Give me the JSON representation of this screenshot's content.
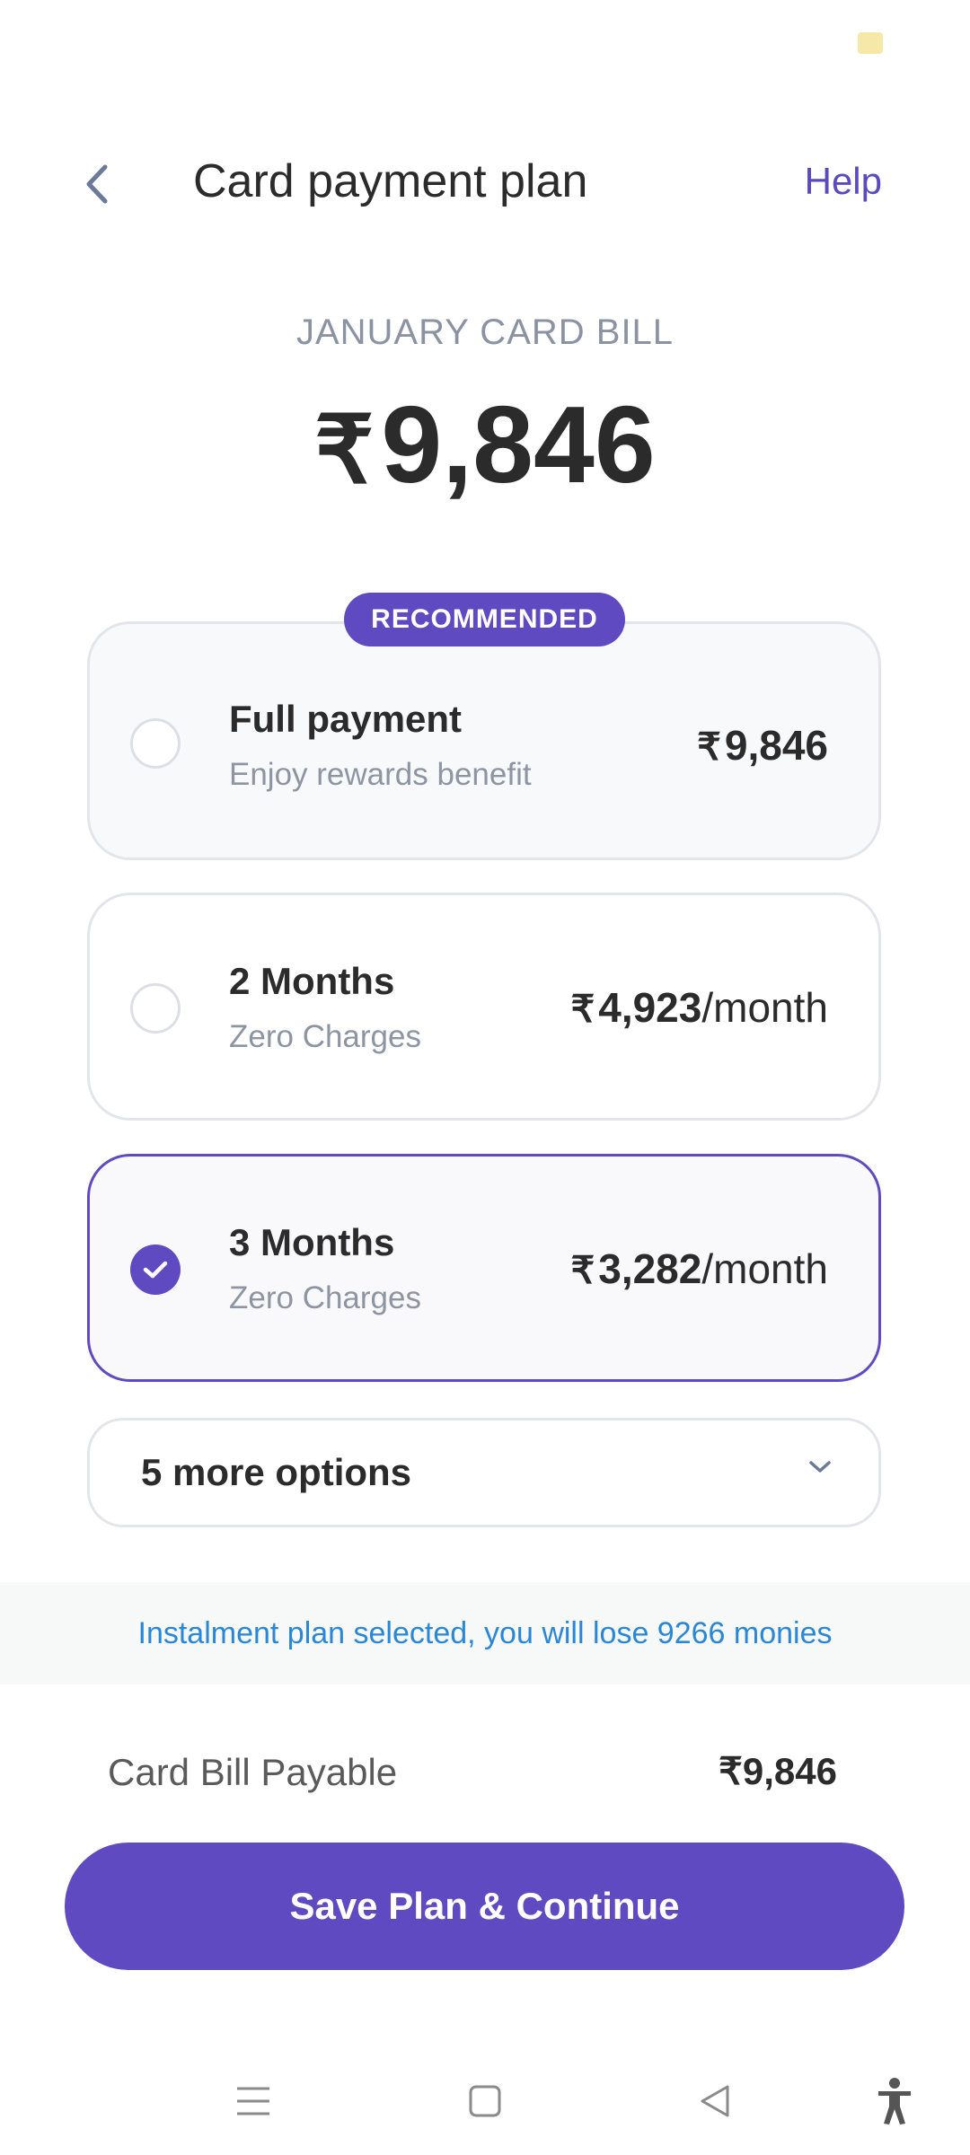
{
  "header": {
    "title": "Card payment plan",
    "help_label": "Help"
  },
  "bill": {
    "label": "JANUARY CARD BILL",
    "currency": "₹",
    "amount": "9,846"
  },
  "plans": [
    {
      "badge": "RECOMMENDED",
      "title": "Full payment",
      "subtitle": "Enjoy rewards benefit",
      "currency": "₹",
      "price": "9,846",
      "suffix": "",
      "selected": false
    },
    {
      "title": "2 Months",
      "subtitle": "Zero Charges",
      "currency": "₹",
      "price": "4,923",
      "suffix": "/month",
      "selected": false
    },
    {
      "title": "3 Months",
      "subtitle": "Zero Charges",
      "currency": "₹",
      "price": "3,282",
      "suffix": "/month",
      "selected": true
    }
  ],
  "more_options": {
    "label": "5 more options"
  },
  "info": {
    "message": "Instalment plan selected, you will lose 9266 monies"
  },
  "payable": {
    "label": "Card Bill Payable",
    "currency": "₹",
    "amount": "9,846"
  },
  "cta": {
    "label": "Save Plan & Continue"
  },
  "icons": {
    "back": "chevron-left-icon",
    "check": "check-icon",
    "expand": "chevron-down-icon",
    "nav_menu": "menu-icon",
    "nav_home": "square-icon",
    "nav_back": "triangle-back-icon",
    "accessibility": "accessibility-icon"
  },
  "colors": {
    "accent": "#5f4ac2",
    "info_text": "#2a87d8",
    "muted_text": "#8e95a2"
  }
}
